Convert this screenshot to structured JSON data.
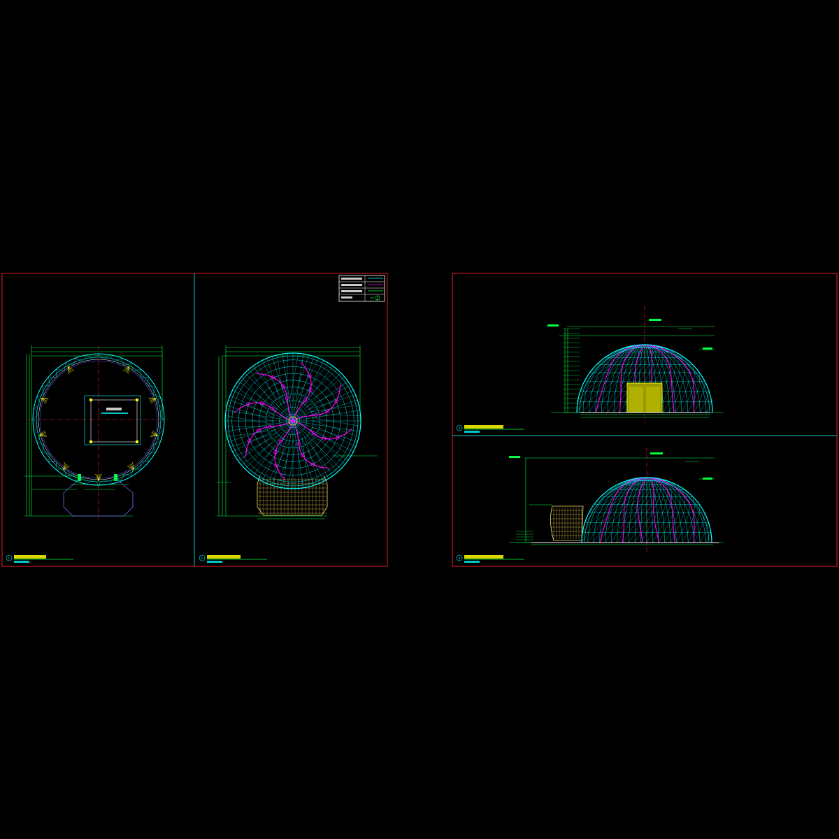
{
  "colors": {
    "background": "#000000",
    "frame": "#e0202a",
    "divider": "#00c8c8",
    "dimension": "#00ff40",
    "structure": "#00ffff",
    "node": "#ff00ff",
    "highlight": "#ffff00",
    "axis": "#ff2020",
    "title_bar": "#00ff40",
    "annex": "#ffe060",
    "door_fill": "#9a9a00",
    "white_line": "#ffffff"
  },
  "sheets": [
    {
      "name": "left-sheet",
      "label": "sheet-1"
    },
    {
      "name": "right-sheet",
      "label": "sheet-2"
    }
  ],
  "views": [
    {
      "id": "view-plan",
      "index": "1",
      "title": "",
      "scale": ""
    },
    {
      "id": "view-roof-plan",
      "index": "2",
      "title": "",
      "scale": ""
    },
    {
      "id": "view-front-elevation",
      "index": "3",
      "title": "",
      "scale": ""
    },
    {
      "id": "view-side-elevation",
      "index": "4",
      "title": "",
      "scale": ""
    }
  ],
  "legend": {
    "rows": [
      "",
      "",
      "",
      ""
    ]
  },
  "icons": [
    "section-marker-icon",
    "north-marker-icon"
  ]
}
